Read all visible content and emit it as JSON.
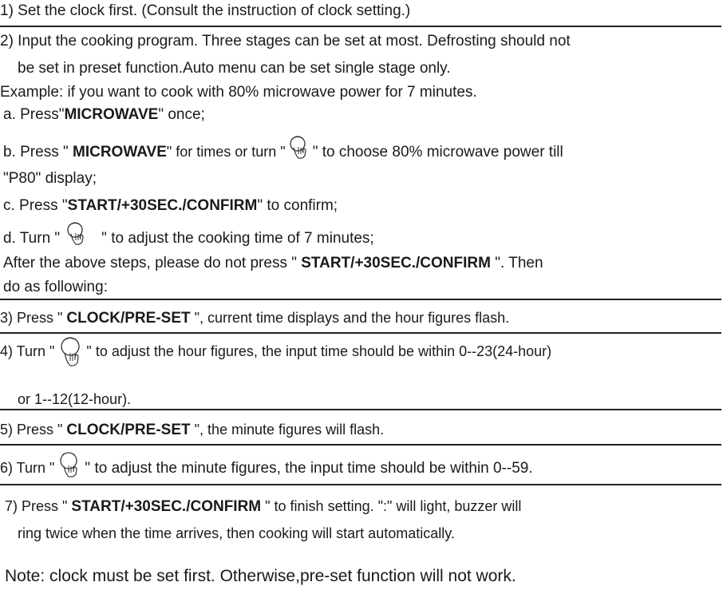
{
  "page": {
    "step1": "1) Set the clock first. (Consult the instruction of clock setting.)",
    "step2_line1": "2) Input the cooking program. Three stages can be set at most. Defrosting should not",
    "step2_line2": "be set in preset function.Auto menu can be set single stage only.",
    "example": "Example: if you want to cook with 80% microwave power for 7 minutes.",
    "a_pre": "a. Press\"",
    "a_bold": "MICROWAVE",
    "a_post": "\" once;",
    "b_pre": "b. Press \" ",
    "b_bold": "MICROWAVE",
    "b_mid": "\" for times or turn \"",
    "b_post": "\" to choose 80% microwave power till",
    "b_line2": "\"P80\" display;",
    "c_pre": "c. Press \"",
    "c_bold": "START/+30SEC./CONFIRM",
    "c_post": "\" to confirm;",
    "d_pre": "d. Turn \"",
    "d_post": "\" to adjust the cooking time of 7 minutes;",
    "after_pre": "After the above steps, please do not press \" ",
    "after_bold": "START/+30SEC./CONFIRM",
    "after_post": " \". Then",
    "after_line2": "do as following:",
    "step3_pre": "3) Press \" ",
    "step3_bold": "CLOCK/PRE-SET",
    "step3_post": " \", current time displays and the hour figures flash.",
    "step4_pre": "4) Turn \"",
    "step4_post": "\" to adjust the hour figures, the input time should be within  0--23(24-hour)",
    "step4_line2": "or 1--12(12-hour).",
    "step5_pre": "5) Press \" ",
    "step5_bold": "CLOCK/PRE-SET",
    "step5_post": " \", the minute figures will flash.",
    "step6_pre": "6) Turn \"",
    "step6_post": "\" to adjust the minute figures, the input time should be within 0--59.",
    "step7_pre": "7) Press \" ",
    "step7_bold": "START/+30SEC./CONFIRM",
    "step7_post": " \" to finish setting. \":\" will light, buzzer will",
    "step7_line2": "ring twice when the time arrives, then cooking will start automatically.",
    "note": "Note: clock must be set first. Otherwise,pre-set function will not work."
  },
  "icons": {
    "knob": "hand-turning-dial-icon"
  }
}
